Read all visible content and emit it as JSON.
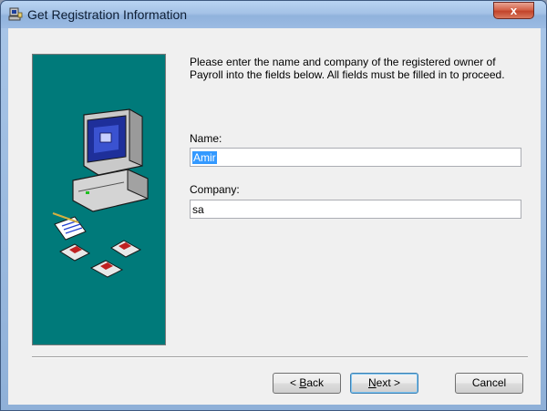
{
  "window": {
    "title": "Get Registration Information",
    "close_glyph": "x",
    "title_icon": "setup-computer-icon"
  },
  "instructions": "Please enter the name and company of the registered owner of Payroll into the fields below. All fields must be filled in to proceed.",
  "form": {
    "name_label": "Name:",
    "name_value": "Amir",
    "company_label": "Company:",
    "company_value": "sa"
  },
  "buttons": {
    "back": {
      "prefix": "< ",
      "mnemonic": "B",
      "rest": "ack"
    },
    "next": {
      "mnemonic": "N",
      "rest": "ext >"
    },
    "cancel": "Cancel"
  },
  "colors": {
    "banner": "#007a7a",
    "selection": "#3399ff",
    "close_button": "#c2442b"
  }
}
